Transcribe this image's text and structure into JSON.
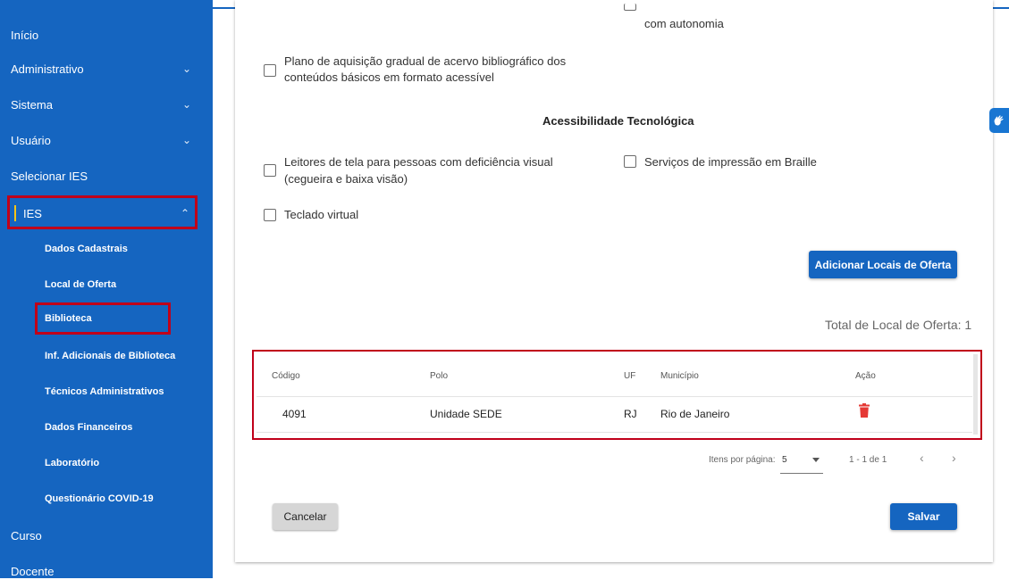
{
  "sidebar": {
    "items": [
      {
        "label": "Início"
      },
      {
        "label": "Administrativo"
      },
      {
        "label": "Sistema"
      },
      {
        "label": "Usuário"
      },
      {
        "label": "Selecionar IES"
      },
      {
        "label": "IES"
      },
      {
        "label": "Curso"
      },
      {
        "label": "Docente"
      }
    ],
    "ies_sub": [
      {
        "label": "Dados Cadastrais"
      },
      {
        "label": "Local de Oferta"
      },
      {
        "label": "Biblioteca"
      },
      {
        "label": "Inf. Adicionais de Biblioteca"
      },
      {
        "label": "Técnicos Administrativos"
      },
      {
        "label": "Dados Financeiros"
      },
      {
        "label": "Laboratório"
      },
      {
        "label": "Questionário COVID-19"
      }
    ]
  },
  "form": {
    "partial_top_right": "com autonomia",
    "acervo_line1": "Plano de aquisição gradual de acervo bibliográfico dos",
    "acervo_line2": "conteúdos básicos em formato acessível",
    "section_title": "Acessibilidade Tecnológica",
    "leitores_line1": "Leitores de tela para pessoas com deficiência visual",
    "leitores_line2": "(cegueira e baixa visão)",
    "braille": "Serviços de impressão em Braille",
    "teclado": "Teclado virtual",
    "add_button": "Adicionar Locais de Oferta",
    "total": "Total de Local de Oferta: 1"
  },
  "table": {
    "headers": {
      "codigo": "Código",
      "polo": "Polo",
      "uf": "UF",
      "municipio": "Município",
      "acao": "Ação"
    },
    "rows": [
      {
        "codigo": "4091",
        "polo": "Unidade SEDE",
        "uf": "RJ",
        "municipio": "Rio de Janeiro"
      }
    ]
  },
  "paginator": {
    "items_label": "Itens por página:",
    "page_size": "5",
    "range": "1 - 1 de 1"
  },
  "actions": {
    "cancel": "Cancelar",
    "save": "Salvar"
  },
  "colors": {
    "primary": "#1565c0",
    "highlight": "#c0001a",
    "delete": "#e53935"
  }
}
